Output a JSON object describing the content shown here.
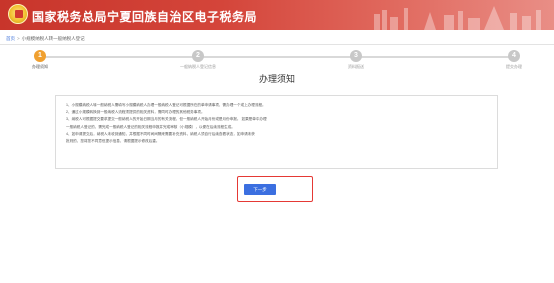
{
  "header": {
    "title": "国家税务总局宁夏回族自治区电子税务局"
  },
  "breadcrumb": {
    "home": "首页",
    "separator": ">",
    "current": "小规模纳税人转一般纳税人登记"
  },
  "steps": [
    {
      "number": "1",
      "label": "办理须知",
      "active": true
    },
    {
      "number": "2",
      "label": "一般纳税人登记信息",
      "active": false
    },
    {
      "number": "3",
      "label": "资料报送",
      "active": false
    },
    {
      "number": "4",
      "label": "提交办理",
      "active": false
    }
  ],
  "progress": {
    "completed_fraction": 0.0
  },
  "page_title": "办理须知",
  "notice": {
    "items": [
      "1、小规模纳税人转一般纳税人需填写小规模纳税人办理一般纳税人登记可根据所在的单申请事项，需办理一个或上办理流程。",
      "2、通过小规模转换到一般纳税人流程须提供的相关资料，需同时办理的其他税务事项。",
      "3、纳税人可根据提交要求提交一般纳税人的开始日期当月的有关流程，但一般纳税人开始月份或是月份申报。  如果是单中办理",
      "   一般纳税人登记的，需完成一般纳税人登记的相关流程申报并完成审核（小规模），以便在后续流程生成。",
      "4、如申请提交后，纳税人未收到通知，并根据不同时间间隔来需要补充资料，纳税人须自行后续查看状态，如申请未获",
      "   批则的，您将您不同意但提示信息，请根据提示修改后重。"
    ]
  },
  "buttons": {
    "next": "下一步"
  },
  "colors": {
    "header_red": "#c8352b",
    "step_active": "#f0a030",
    "button_blue": "#3b6fe0",
    "highlight_border": "#e53935"
  }
}
